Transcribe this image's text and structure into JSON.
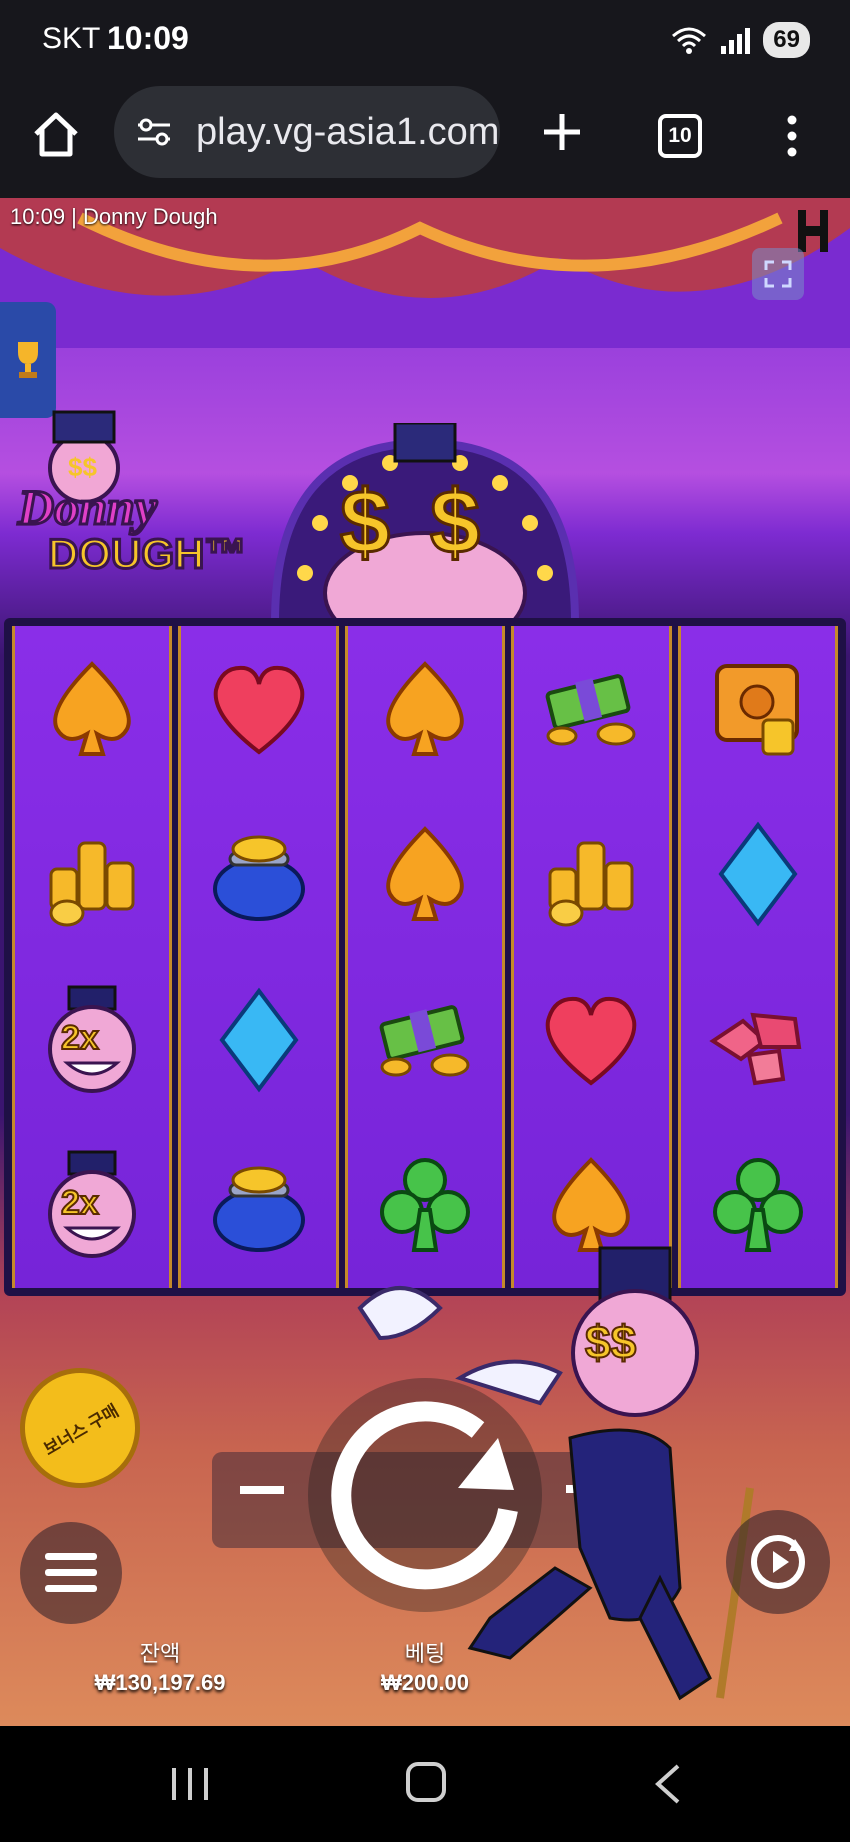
{
  "status_bar": {
    "carrier": "SKT",
    "time": "10:09",
    "battery": "69"
  },
  "browser": {
    "url": "play.vg-asia1.com",
    "tab_count": "10"
  },
  "game": {
    "clock": "10:09",
    "title": "Donny Dough",
    "logo_line1": "Donny",
    "logo_line2": "DOUGH™",
    "bonus_buy_label": "보너스 구매",
    "balance_label": "잔액",
    "balance_value": "₩130,197.69",
    "bet_label": "베팅",
    "bet_value": "₩200.00",
    "reels": [
      [
        "spade-orange",
        "coin-stack",
        "multiplier-2x",
        "multiplier-2x"
      ],
      [
        "heart-red",
        "coin-purse",
        "diamond-blue",
        "coin-purse"
      ],
      [
        "spade-orange",
        "spade-orange",
        "cash-stack",
        "club-green"
      ],
      [
        "cash-stack",
        "coin-stack",
        "heart-red",
        "spade-orange"
      ],
      [
        "safe-gold",
        "diamond-blue",
        "ruby-gems",
        "club-green"
      ]
    ],
    "multiplier_label": "2x",
    "colors": {
      "reel_bg": "#7a27da",
      "frame": "#1f1046",
      "accent_gold": "#f3bd1b"
    }
  }
}
